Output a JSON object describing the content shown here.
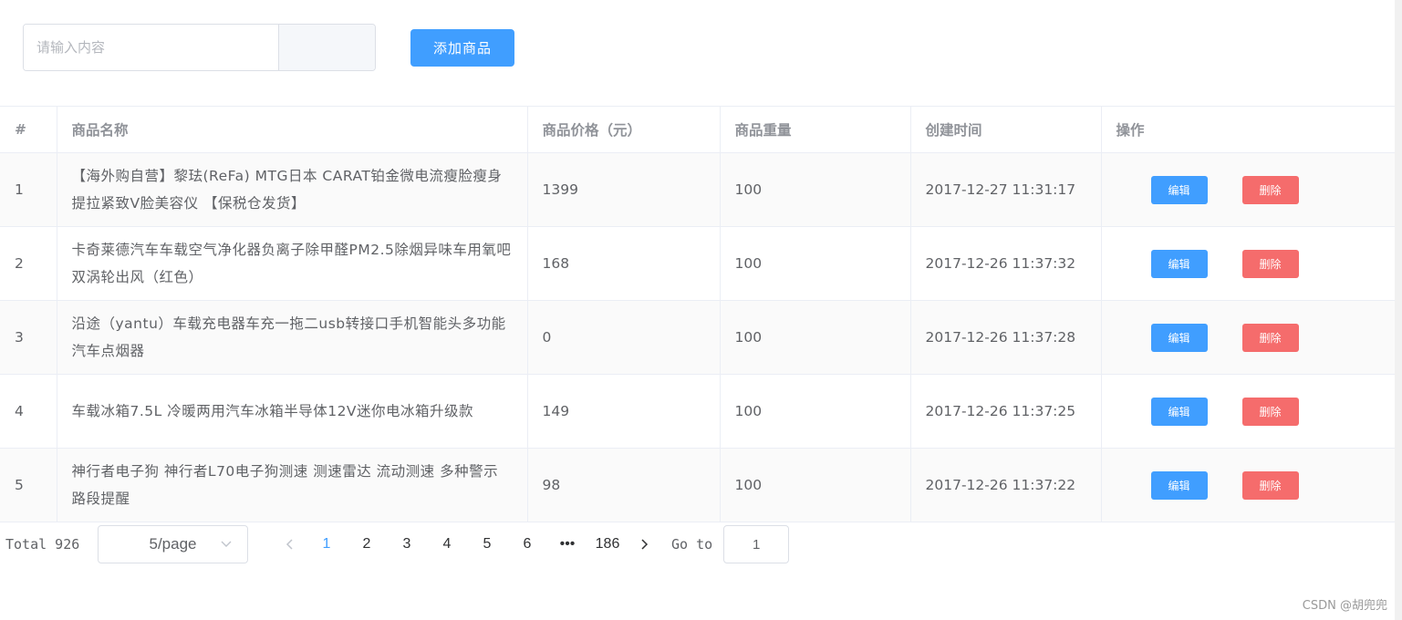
{
  "toolbar": {
    "search_placeholder": "请输入内容",
    "add_label": "添加商品"
  },
  "table": {
    "headers": [
      "#",
      "商品名称",
      "商品价格（元）",
      "商品重量",
      "创建时间",
      "操作"
    ],
    "rows": [
      {
        "index": "1",
        "name": "【海外购自营】黎珐(ReFa) MTG日本 CARAT铂金微电流瘦脸瘦身提拉紧致V脸美容仪 【保税仓发货】",
        "price": "1399",
        "weight": "100",
        "time": "2017-12-27 11:31:17"
      },
      {
        "index": "2",
        "name": "卡奇莱德汽车车载空气净化器负离子除甲醛PM2.5除烟异味车用氧吧双涡轮出风（红色）",
        "price": "168",
        "weight": "100",
        "time": "2017-12-26 11:37:32"
      },
      {
        "index": "3",
        "name": "沿途（yantu）车载充电器车充一拖二usb转接口手机智能头多功能汽车点烟器",
        "price": "0",
        "weight": "100",
        "time": "2017-12-26 11:37:28"
      },
      {
        "index": "4",
        "name": "车载冰箱7.5L 冷暖两用汽车冰箱半导体12V迷你电冰箱升级款",
        "price": "149",
        "weight": "100",
        "time": "2017-12-26 11:37:25"
      },
      {
        "index": "5",
        "name": "神行者电子狗 神行者L70电子狗测速 测速雷达 流动测速 多种警示路段提醒",
        "price": "98",
        "weight": "100",
        "time": "2017-12-26 11:37:22"
      }
    ],
    "edit_label": "编辑",
    "delete_label": "删除"
  },
  "pagination": {
    "total": "Total 926",
    "page_size": "5/page",
    "pages": [
      "1",
      "2",
      "3",
      "4",
      "5",
      "6"
    ],
    "ellipsis": "•••",
    "last_page": "186",
    "current_page": "1",
    "goto_label": "Go to",
    "goto_value": "1"
  },
  "watermark": "CSDN @胡兜兜",
  "colors": {
    "primary": "#409eff",
    "danger": "#f56c6c",
    "border": "#ebeef5"
  }
}
